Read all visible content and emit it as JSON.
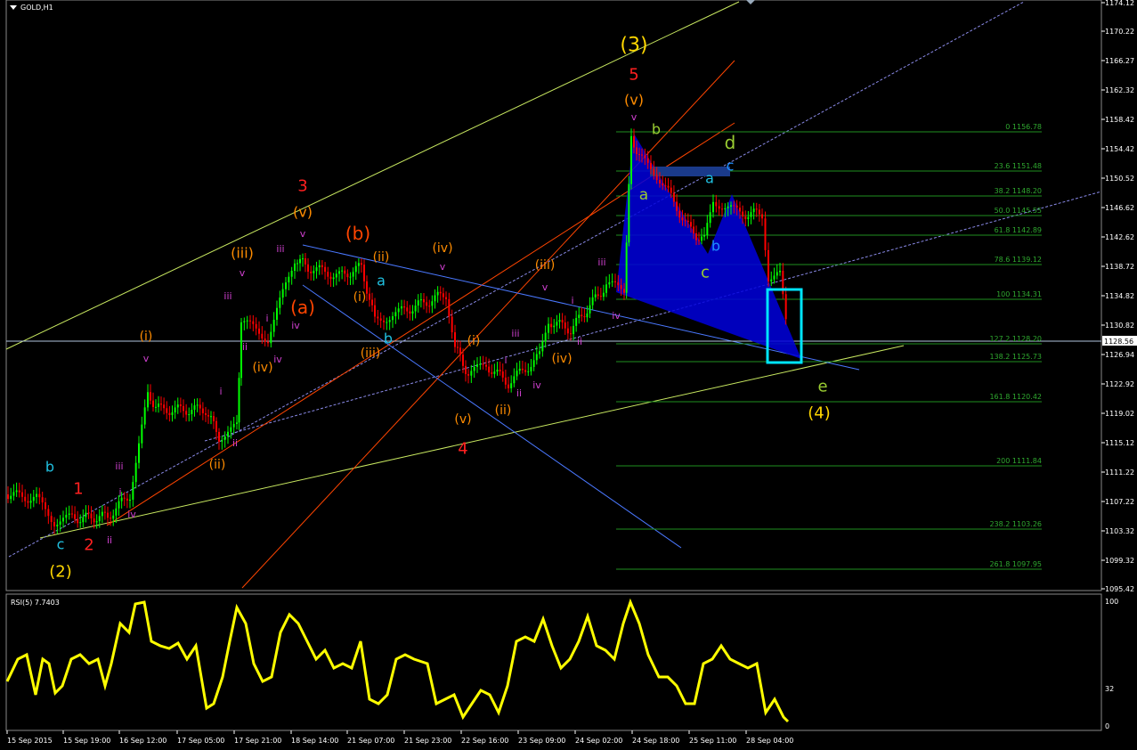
{
  "header": {
    "symbol": "GOLD,H1"
  },
  "rsi": {
    "label": "RSI(5) 7.7403",
    "levels": [
      "100",
      "32",
      "0"
    ]
  },
  "price_axis": [
    "1174.12",
    "1170.22",
    "1166.27",
    "1162.32",
    "1158.42",
    "1154.42",
    "1150.52",
    "1146.62",
    "1142.62",
    "1138.72",
    "1134.82",
    "1130.82",
    "1126.94",
    "1122.92",
    "1119.02",
    "1115.12",
    "1111.22",
    "1107.22",
    "1103.32",
    "1099.32",
    "1095.42"
  ],
  "current_price": "1128.56",
  "time_axis": [
    "15 Sep 2015",
    "15 Sep 19:00",
    "16 Sep 12:00",
    "17 Sep 05:00",
    "17 Sep 21:00",
    "18 Sep 14:00",
    "21 Sep 07:00",
    "21 Sep 23:00",
    "22 Sep 16:00",
    "23 Sep 09:00",
    "24 Sep 02:00",
    "24 Sep 18:00",
    "25 Sep 11:00",
    "28 Sep 04:00"
  ],
  "fib_levels": [
    "0 1156.78",
    "23.6 1151.48",
    "38.2 1148.20",
    "50.0 1145.55",
    "61.8 1142.89",
    "78.6 1139.12",
    "100 1134.31",
    "127.2 1128.20",
    "138.2 1125.73",
    "161.8 1120.42",
    "200 1111.84",
    "238.2 1103.26",
    "261.8 1097.95"
  ],
  "wave_labels": [
    "(3)",
    "5",
    "(v)",
    "v",
    "b",
    "d",
    "c",
    "a",
    "a",
    "b",
    "c",
    "3",
    "(v)",
    "v",
    "(b)",
    "(iii)",
    "v",
    "iii",
    "(ii)",
    "a",
    "(i)",
    "(a)",
    "iii",
    "i",
    "iv",
    "ii",
    "(iv)",
    "(iv)",
    "v",
    "(iii)",
    "v",
    "iii",
    "i",
    "(iii)",
    "b",
    "(i)",
    "v",
    "i",
    "(i)",
    "iii",
    "iv",
    "i",
    "(iv)",
    "ii",
    "(ii)",
    "ii",
    "(v)",
    "4",
    "iv",
    "iv",
    "ii",
    "(ii)",
    "iii",
    "i",
    "iv",
    "b",
    "1",
    "2",
    "c",
    "ii",
    "(2)",
    "e",
    "(4)"
  ],
  "colors": {
    "background": "#000000",
    "price_line": "#b0c4de",
    "rsi_line": "#ffff00",
    "up_candle": "#00ff00",
    "down_candle": "#ff0000",
    "fib_line": "#1f8f1f",
    "harmonic_fill": "#0000cc",
    "box": "#00e5ff"
  }
}
